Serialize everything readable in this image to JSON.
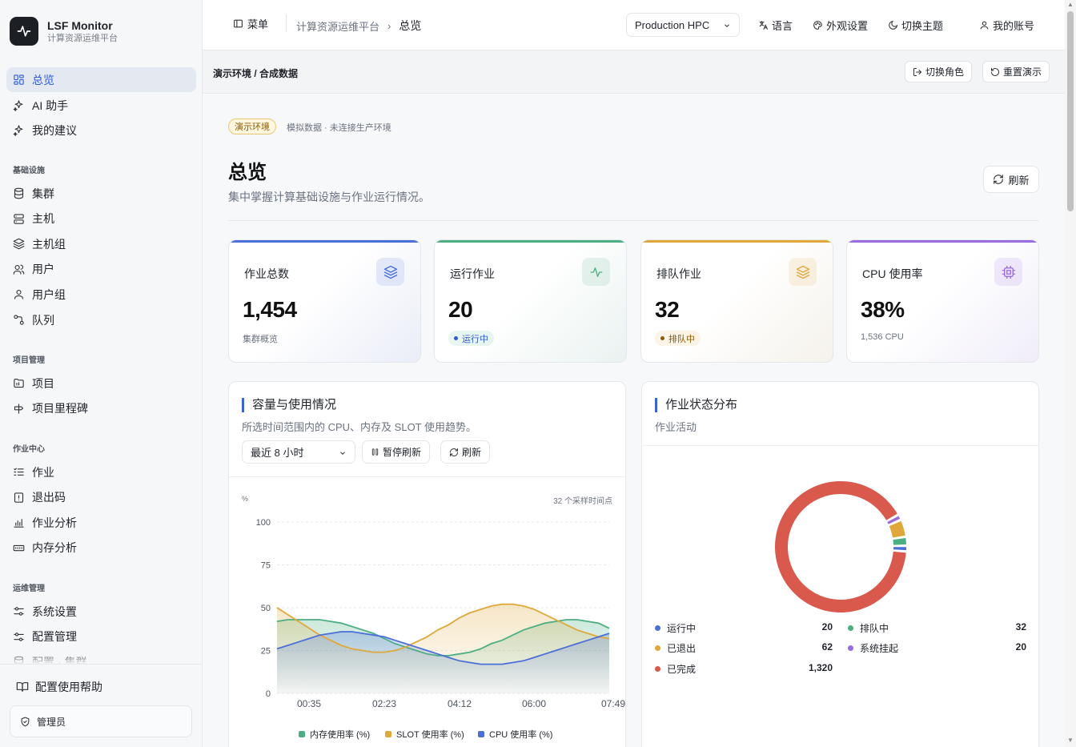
{
  "brand": {
    "name": "LSF Monitor",
    "subtitle": "计算资源运维平台"
  },
  "nav": {
    "top": [
      {
        "label": "总览",
        "icon": "dashboard-icon",
        "active": true
      },
      {
        "label": "AI 助手",
        "icon": "sparkles-icon"
      },
      {
        "label": "我的建议",
        "icon": "sparkles-icon"
      }
    ],
    "sections": [
      {
        "title": "基础设施",
        "items": [
          {
            "label": "集群",
            "icon": "database-icon"
          },
          {
            "label": "主机",
            "icon": "server-icon"
          },
          {
            "label": "主机组",
            "icon": "layers-icon"
          },
          {
            "label": "用户",
            "icon": "users-icon"
          },
          {
            "label": "用户组",
            "icon": "user-icon"
          },
          {
            "label": "队列",
            "icon": "queue-icon"
          }
        ]
      },
      {
        "title": "项目管理",
        "items": [
          {
            "label": "项目",
            "icon": "folder-icon"
          },
          {
            "label": "项目里程碑",
            "icon": "milestone-icon"
          }
        ]
      },
      {
        "title": "作业中心",
        "items": [
          {
            "label": "作业",
            "icon": "list-icon"
          },
          {
            "label": "退出码",
            "icon": "alert-icon"
          },
          {
            "label": "作业分析",
            "icon": "bar-chart-icon"
          },
          {
            "label": "内存分析",
            "icon": "memory-icon"
          }
        ]
      },
      {
        "title": "运维管理",
        "items": [
          {
            "label": "系统设置",
            "icon": "sliders-icon"
          },
          {
            "label": "配置管理",
            "icon": "sliders-icon"
          },
          {
            "label": "配置 · 集群",
            "icon": "database-icon"
          }
        ]
      }
    ],
    "help": "配置使用帮助",
    "role": "管理员"
  },
  "topbar": {
    "menu": "菜单",
    "breadcrumb": [
      "计算资源运维平台",
      "总览"
    ],
    "cluster": "Production HPC",
    "actions": [
      "语言",
      "外观设置",
      "切换主题",
      "我的账号"
    ]
  },
  "demo": {
    "label": "演示环境 / 合成数据",
    "switch_role": "切换角色",
    "reset": "重置演示"
  },
  "page": {
    "env_badge": "演示环境",
    "env_note": "模拟数据 · 未连接生产环境",
    "title": "总览",
    "subtitle": "集中掌握计算基础设施与作业运行情况。",
    "refresh": "刷新"
  },
  "kpis": [
    {
      "label": "作业总数",
      "value": "1,454",
      "note": "集群概览",
      "color": "#4a6fd8",
      "icon": "layers-icon"
    },
    {
      "label": "运行作业",
      "value": "20",
      "pill": "运行中",
      "color": "#4caf82",
      "icon": "activity-icon"
    },
    {
      "label": "排队作业",
      "value": "32",
      "pill": "排队中",
      "color": "#e0a83a",
      "icon": "layers-icon"
    },
    {
      "label": "CPU 使用率",
      "value": "38%",
      "note": "1,536 CPU",
      "color": "#9b6be0",
      "icon": "cpu-icon"
    }
  ],
  "capacity": {
    "title": "容量与使用情况",
    "subtitle": "所选时间范围内的 CPU、内存及 SLOT 使用趋势。",
    "range": "最近 8 小时",
    "pause": "暂停刷新",
    "refresh": "刷新",
    "unit": "%",
    "count_note": "32 个采样时间点"
  },
  "distribution": {
    "title": "作业状态分布",
    "subtitle": "作业活动",
    "items": [
      {
        "label": "运行中",
        "value": 20,
        "display": "20",
        "color": "#4a6fd8"
      },
      {
        "label": "排队中",
        "value": 32,
        "display": "32",
        "color": "#4caf82"
      },
      {
        "label": "已退出",
        "value": 62,
        "display": "62",
        "color": "#e0a83a"
      },
      {
        "label": "系统挂起",
        "value": 20,
        "display": "20",
        "color": "#9b6be0"
      },
      {
        "label": "已完成",
        "value": 1320,
        "display": "1,320",
        "color": "#d9594c"
      }
    ]
  },
  "chart_data": [
    {
      "type": "area",
      "title": "容量与使用情况",
      "ylabel": "%",
      "ylim": [
        0,
        100
      ],
      "yticks": [
        0,
        25,
        50,
        75,
        100
      ],
      "x_ticks": [
        "00:35",
        "02:23",
        "04:12",
        "06:00",
        "07:49"
      ],
      "x": [
        "00:00",
        "00:15",
        "00:30",
        "00:45",
        "01:00",
        "01:15",
        "01:30",
        "01:45",
        "02:00",
        "02:15",
        "02:30",
        "02:45",
        "03:00",
        "03:15",
        "03:30",
        "03:45",
        "04:00",
        "04:15",
        "04:30",
        "04:45",
        "05:00",
        "05:15",
        "05:30",
        "05:45",
        "06:00",
        "06:15",
        "06:30",
        "06:45",
        "07:00",
        "07:15",
        "07:30",
        "07:45"
      ],
      "series": [
        {
          "name": "内存使用率 (%)",
          "color": "#4caf82",
          "values": [
            42,
            43,
            43,
            43,
            43,
            42,
            41,
            39,
            37,
            35,
            32,
            29,
            27,
            25,
            23,
            22,
            22,
            23,
            24,
            26,
            29,
            31,
            34,
            37,
            39,
            41,
            42,
            43,
            43,
            42,
            41,
            38
          ]
        },
        {
          "name": "SLOT 使用率 (%)",
          "color": "#e0a83a",
          "values": [
            50,
            46,
            42,
            38,
            34,
            31,
            28,
            26,
            25,
            24,
            24,
            25,
            27,
            30,
            33,
            37,
            40,
            44,
            47,
            49,
            51,
            52,
            52,
            51,
            49,
            46,
            43,
            40,
            37,
            35,
            33,
            32
          ]
        },
        {
          "name": "CPU 使用率 (%)",
          "color": "#4a6fd8",
          "values": [
            26,
            28,
            30,
            32,
            34,
            35,
            36,
            36,
            35,
            34,
            33,
            31,
            29,
            27,
            25,
            23,
            21,
            19,
            18,
            17,
            17,
            17,
            18,
            19,
            21,
            23,
            25,
            27,
            29,
            31,
            33,
            35
          ]
        }
      ]
    },
    {
      "type": "pie",
      "title": "作业状态分布",
      "categories": [
        "运行中",
        "排队中",
        "已退出",
        "系统挂起",
        "已完成"
      ],
      "values": [
        20,
        32,
        62,
        20,
        1320
      ]
    }
  ]
}
